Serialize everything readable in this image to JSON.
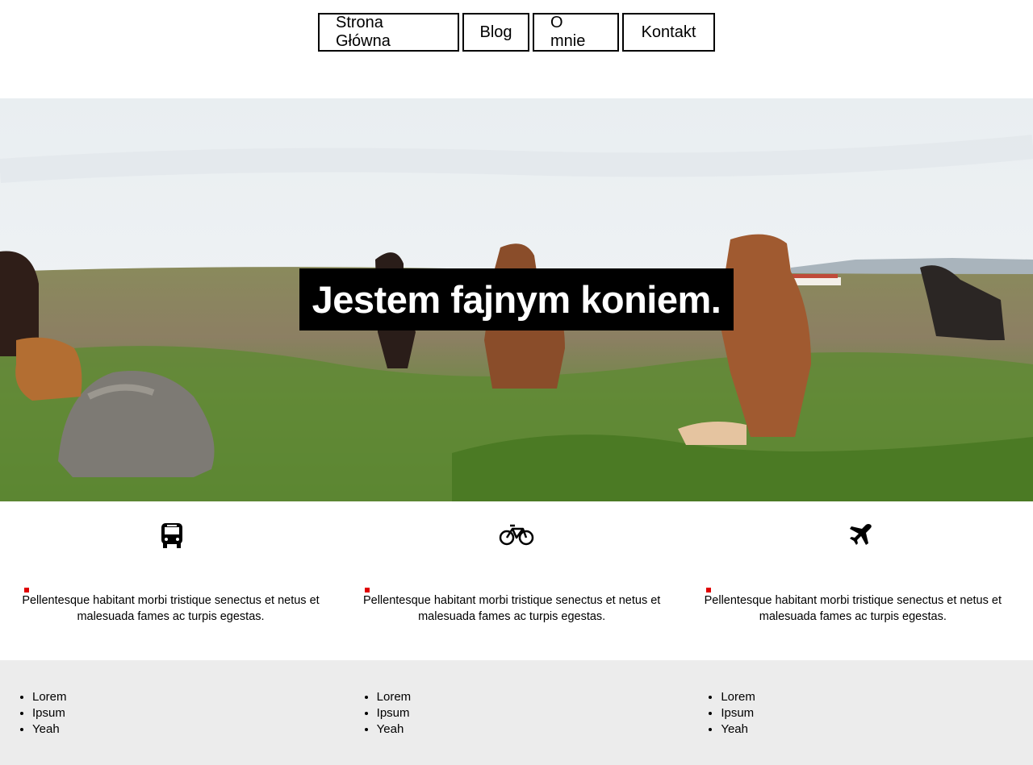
{
  "nav": {
    "items": [
      {
        "label": "Strona Główna"
      },
      {
        "label": "Blog"
      },
      {
        "label": "O mnie"
      },
      {
        "label": "Kontakt"
      }
    ]
  },
  "hero": {
    "title": "Jestem fajnym koniem."
  },
  "features": [
    {
      "icon": "bus-icon",
      "text": "Pellentesque habitant morbi tristique senectus et netus et malesuada fames ac turpis egestas."
    },
    {
      "icon": "bicycle-icon",
      "text": "Pellentesque habitant morbi tristique senectus et netus et malesuada fames ac turpis egestas."
    },
    {
      "icon": "airplane-icon",
      "text": "Pellentesque habitant morbi tristique senectus et netus et malesuada fames ac turpis egestas."
    }
  ],
  "footer": {
    "columns": [
      {
        "items": [
          "Lorem",
          "Ipsum",
          "Yeah"
        ]
      },
      {
        "items": [
          "Lorem",
          "Ipsum",
          "Yeah"
        ]
      },
      {
        "items": [
          "Lorem",
          "Ipsum",
          "Yeah"
        ]
      }
    ]
  },
  "colors": {
    "accent_marker": "#e00000",
    "footer_bg": "#ececec",
    "title_bg": "#000000"
  }
}
